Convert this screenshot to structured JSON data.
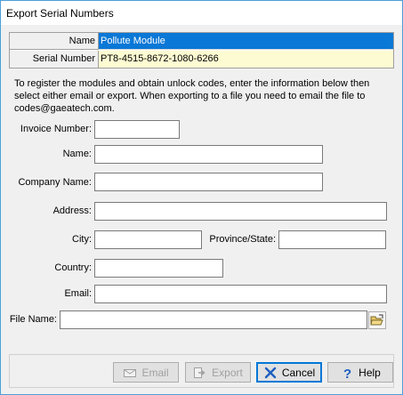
{
  "window": {
    "title": "Export Serial Numbers"
  },
  "grid": {
    "rows": [
      {
        "label": "Name",
        "value": "Pollute Module"
      },
      {
        "label": "Serial Number",
        "value": "PT8-4515-8672-1080-6266"
      }
    ]
  },
  "intro_text": "To register the modules and obtain unlock codes, enter the information below then select either email or export. When exporting to a file you need to email the file to codes@gaeatech.com.",
  "form": {
    "invoice_label": "Invoice Number:",
    "invoice_value": "",
    "name_label": "Name:",
    "name_value": "",
    "company_label": "Company Name:",
    "company_value": "",
    "address_label": "Address:",
    "address_value": "",
    "city_label": "City:",
    "city_value": "",
    "province_label": "Province/State:",
    "province_value": "",
    "country_label": "Country:",
    "country_value": "",
    "email_label": "Email:",
    "email_value": "",
    "file_label": "File Name:",
    "file_value": ""
  },
  "buttons": {
    "email": "Email",
    "export": "Export",
    "cancel": "Cancel",
    "help": "Help"
  },
  "colors": {
    "selected_row": "#0a78d6",
    "serial_row": "#fdfbd2",
    "default_button_border": "#0078d7",
    "cancel_icon": "#1e5fbf",
    "help_icon": "#1e5fbf"
  },
  "icons": {
    "email": "envelope-icon",
    "export": "export-arrow-icon",
    "cancel": "x-icon",
    "help": "question-mark-icon",
    "browse": "open-folder-icon"
  }
}
